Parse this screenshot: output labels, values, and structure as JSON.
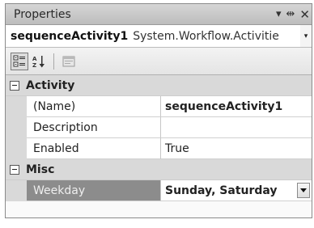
{
  "window": {
    "title": "Properties",
    "pin_glyph": "▾",
    "autohide_glyph": "⇹",
    "close_glyph": "✕"
  },
  "object_selector": {
    "name": "sequenceActivity1",
    "type": "System.Workflow.Activitie",
    "dropdown_glyph": "▾"
  },
  "toolbar": {
    "buttons": [
      {
        "icon": "categorized-icon",
        "pressed": true
      },
      {
        "icon": "alphabetical-icon",
        "pressed": false
      },
      {
        "icon": "property-pages-icon",
        "pressed": false
      }
    ]
  },
  "grid": {
    "categories": [
      {
        "label": "Activity",
        "properties": [
          {
            "name": "(Name)",
            "value": "sequenceActivity1",
            "bold": true
          },
          {
            "name": "Description",
            "value": "",
            "bold": false
          },
          {
            "name": "Enabled",
            "value": "True",
            "bold": false
          }
        ]
      },
      {
        "label": "Misc",
        "properties": [
          {
            "name": "Weekday",
            "value": "Sunday, Saturday",
            "bold": true,
            "selected": true,
            "has_dropdown": true
          }
        ]
      }
    ]
  },
  "colors": {
    "title_bar": "#c8c8c8",
    "category_background": "#d9d9d9",
    "selected_row": "#8c8c8c"
  }
}
